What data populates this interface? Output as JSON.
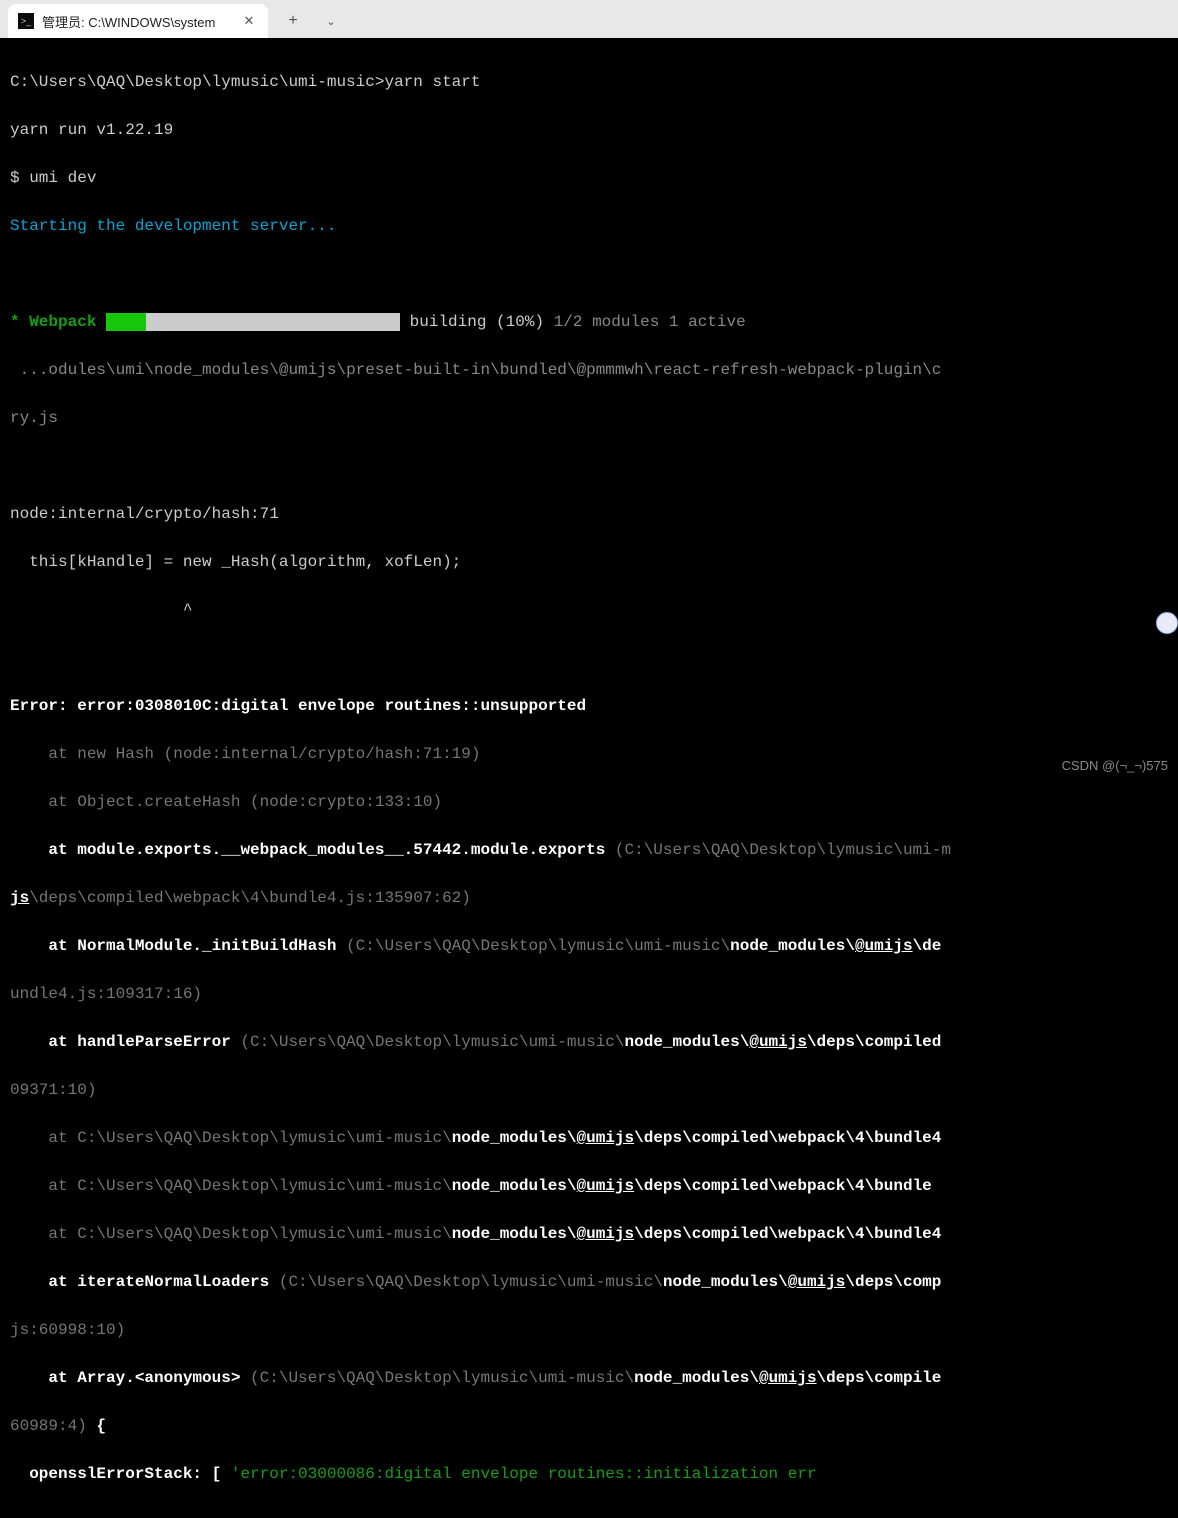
{
  "tab": {
    "title": "管理员:  C:\\WINDOWS\\system"
  },
  "prompt": {
    "path": "C:\\Users\\QAQ\\Desktop\\lymusic\\umi-music>",
    "command": "yarn start"
  },
  "yarn_run": "yarn run v1.22.19",
  "umi_dev": "$ umi dev",
  "starting": "Starting the development server...",
  "webpack": {
    "label": "* Webpack",
    "building": "building (10%)",
    "modules_info": "1/2 modules 1 active",
    "progress_pct": 10
  },
  "module_path": " ...odules\\umi\\node_modules\\@umijs\\preset-built-in\\bundled\\@pmmmwh\\react-refresh-webpack-plugin\\c",
  "module_path2": "ry.js",
  "node_intern": "node:internal/crypto/hash:71",
  "hash_line": "  this[kHandle] = new _Hash(algorithm, xofLen);",
  "caret_line": "                  ^",
  "error_main": "Error: error:0308010C:digital envelope routines::unsupported",
  "trace": {
    "l1": "    at new Hash (node:internal/crypto/hash:71:19)",
    "l2": "    at Object.createHash (node:crypto:133:10)",
    "l3a": "    at module.exports.__webpack_modules__.57442.module.exports",
    "l3b": " (C:\\Users\\QAQ\\Desktop\\lymusic\\umi-m",
    "l3c": "js",
    "l3d": "\\deps\\compiled\\webpack\\4\\bundle4.js:135907:62)",
    "l4a": "    at NormalModule._initBuildHash ",
    "l4b": "(C:\\Users\\QAQ\\Desktop\\lymusic\\umi-music\\",
    "l4c": "node_modules\\",
    "l4d": "@umijs",
    "l4e": "\\de",
    "l4f": "undle4.js:109317:16)",
    "l5a": "    at handleParseError",
    "l5b": " (C:\\Users\\QAQ\\Desktop\\lymusic\\umi-music\\",
    "l5c": "node_modules\\",
    "l5d": "@umijs",
    "l5e": "\\deps\\compiled",
    "l5f": "09371:10)",
    "l6a": "    at ",
    "l6b": "C:\\Users\\QAQ\\Desktop\\lymusic\\umi-music\\",
    "l6c": "node_modules\\",
    "l6d": "@umijs",
    "l6e": "\\deps\\compiled\\webpack\\4\\bundle4",
    "l7e": "\\deps\\compiled\\webpack\\4\\bundle",
    "l8e": "\\deps\\compiled\\webpack\\4\\bundle4",
    "l9a": "    at iterateNormalLoaders",
    "l9b": " (C:\\Users\\QAQ\\Desktop\\lymusic\\umi-music\\",
    "l9c": "node_modules\\",
    "l9d": "@umijs",
    "l9e": "\\deps\\comp",
    "l9f": "js:60998:10)",
    "l10a": "    at Array.<anonymous>",
    "l10b": " (C:\\Users\\QAQ\\Desktop\\lymusic\\umi-music\\",
    "l10c": "node_modules\\",
    "l10d": "@umijs",
    "l10e": "\\deps\\compile",
    "l10f": "60989:4)",
    "l10g": " {"
  },
  "openssl": {
    "label": "  opensslErrorStack: [ ",
    "msg": "'error:03000086:digital envelope routines::initialization err"
  },
  "watermark": "CSDN @(¬_¬)575"
}
